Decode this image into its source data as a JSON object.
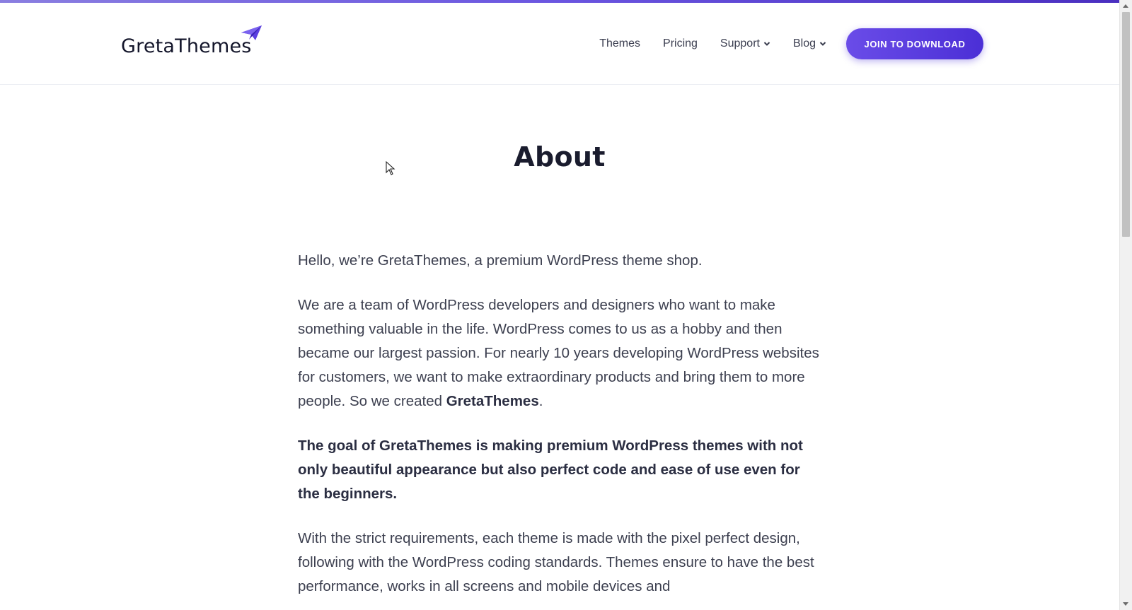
{
  "brand": {
    "name": "GretaThemes",
    "accent": "#5b3fe0",
    "logo_icon": "paper-plane-icon"
  },
  "nav": {
    "items": [
      {
        "label": "Themes",
        "has_dropdown": false
      },
      {
        "label": "Pricing",
        "has_dropdown": false
      },
      {
        "label": "Support",
        "has_dropdown": true
      },
      {
        "label": "Blog",
        "has_dropdown": true
      }
    ],
    "cta_label": "JOIN TO DOWNLOAD"
  },
  "page": {
    "title": "About",
    "intro": "Hello, we’re GretaThemes, a premium WordPress theme shop.",
    "team_paragraph": "We are a team of WordPress developers and designers who want to make something valuable in the life. WordPress comes to us as a hobby and then became our largest passion. For nearly 10 years developing WordPress websites for customers, we want to make extraordinary products and bring them to more people. So we created ",
    "team_paragraph_strong": "GretaThemes",
    "team_paragraph_end": ".",
    "goal": "The goal of GretaThemes is making premium WordPress themes with not only beautiful appearance but also perfect code and ease of use even for the beginners.",
    "requirements": "With the strict requirements, each theme is made with the pixel perfect design, following with the WordPress coding standards. Themes ensure to have the best performance, works in all screens and mobile devices and"
  }
}
